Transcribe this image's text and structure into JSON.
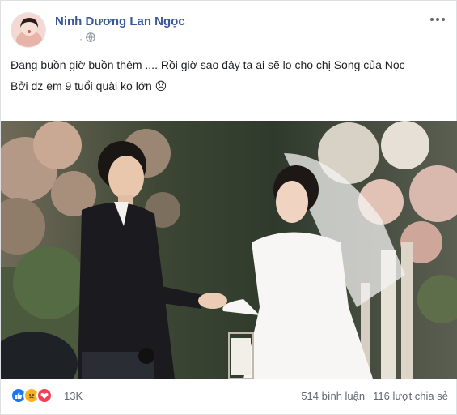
{
  "post": {
    "author": "Ninh Dương Lan Ngọc",
    "timestamp": "·",
    "privacy_icon": "globe-icon",
    "text_line1": "Đang buồn giờ buồn thêm .... Rồi giờ sao đây ta ai sẽ lo cho chị Song của Nọc",
    "text_line2": "Bởi dz em 9 tuổi quài ko lớn 😞"
  },
  "reactions": {
    "icons": [
      "like-icon",
      "sad-icon",
      "love-icon"
    ],
    "count": "13K",
    "comments": "514 bình luận",
    "shares": "116 lượt chia sẻ"
  },
  "colors": {
    "author": "#385898",
    "like": "#1877f2",
    "sad": "#f7b125",
    "love": "#f33e58"
  }
}
